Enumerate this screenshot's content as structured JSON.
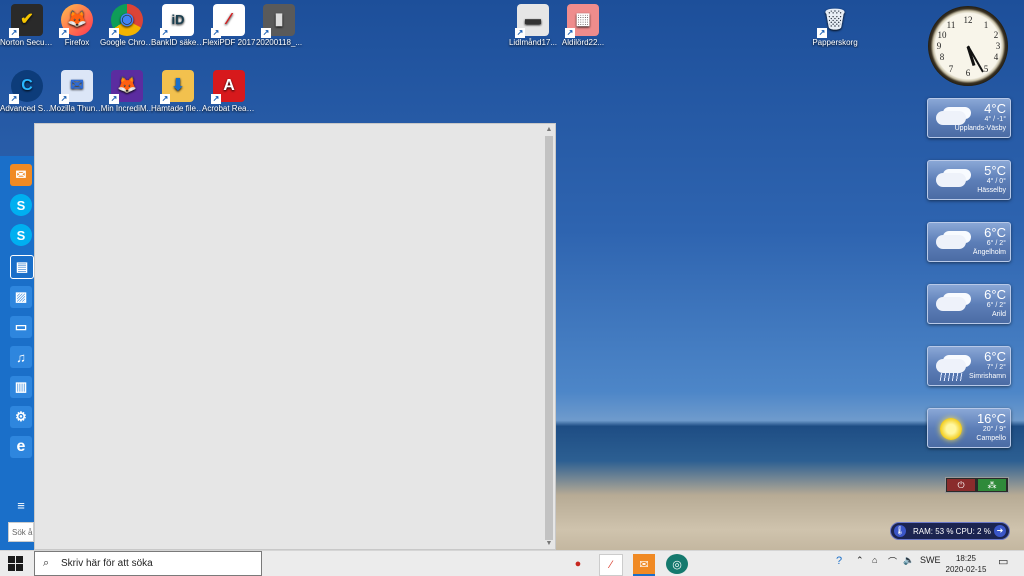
{
  "desktop_icons": [
    {
      "label": "Norton Security",
      "color": "#f5c400",
      "glyph": "✔"
    },
    {
      "label": "Firefox",
      "color": "#ff7139",
      "glyph": "🦊"
    },
    {
      "label": "Google Chrome",
      "color": "#ffffff",
      "glyph": "◉"
    },
    {
      "label": "BankID säkerhetspr...",
      "color": "#ffffff",
      "glyph": "iD"
    },
    {
      "label": "FlexiPDF 2017",
      "color": "#ffffff",
      "glyph": "⁄"
    },
    {
      "label": "20200118_...",
      "color": "#6a6a6a",
      "glyph": "▮"
    },
    {
      "label": "Advanced SystemCare",
      "color": "#0d3c7a",
      "glyph": "C"
    },
    {
      "label": "Mozilla Thunderbird",
      "color": "#2d6bd6",
      "glyph": "✉"
    },
    {
      "label": "Min IncrediM...",
      "color": "#5b2ca0",
      "glyph": "🦊"
    },
    {
      "label": "Hämtade filer - genväg",
      "color": "#f2c14e",
      "glyph": "⬇"
    },
    {
      "label": "Acrobat Reader DC",
      "color": "#d7191c",
      "glyph": "A"
    },
    {
      "label": "Lidlmånd17...",
      "color": "#dcdcdc",
      "glyph": "▬"
    },
    {
      "label": "Aldilörd22...",
      "color": "#ef8c8c",
      "glyph": "▦"
    },
    {
      "label": "Papperskorg",
      "color": "#cfd8e6",
      "glyph": "🗑"
    }
  ],
  "start_rail": {
    "items": [
      {
        "name": "mail-icon",
        "glyph": "✉",
        "color": "#f08a24"
      },
      {
        "name": "skype-icon",
        "glyph": "S",
        "color": "#00aff0"
      },
      {
        "name": "skype-icon",
        "glyph": "S",
        "color": "#00aff0"
      },
      {
        "name": "store-icon",
        "glyph": "▤",
        "color": "#1a6fc9"
      },
      {
        "name": "photos-icon",
        "glyph": "▨",
        "color": "#1a6fc9"
      },
      {
        "name": "video-icon",
        "glyph": "▭",
        "color": "#1a6fc9"
      },
      {
        "name": "music-icon",
        "glyph": "♫",
        "color": "#1a6fc9"
      },
      {
        "name": "files-icon",
        "glyph": "▥",
        "color": "#1a6fc9"
      },
      {
        "name": "settings-icon",
        "glyph": "⚙",
        "color": "#1a6fc9"
      },
      {
        "name": "edge-icon",
        "glyph": "e",
        "color": "#1a6fc9"
      },
      {
        "name": "menu-icon",
        "glyph": "≡",
        "color": "#1a6fc9"
      }
    ],
    "search_text": "Sök å"
  },
  "clock": {
    "hour": 5,
    "minute": 25
  },
  "weather": [
    {
      "temp": "4°C",
      "range": "4° / -1°",
      "city": "Upplands-Väsby",
      "icon": "cloud"
    },
    {
      "temp": "5°C",
      "range": "4° / 0°",
      "city": "Hässelby",
      "icon": "cloud"
    },
    {
      "temp": "6°C",
      "range": "6° / 2°",
      "city": "Ängelholm",
      "icon": "cloud"
    },
    {
      "temp": "6°C",
      "range": "6° / 2°",
      "city": "Arild",
      "icon": "cloud"
    },
    {
      "temp": "6°C",
      "range": "7° / 2°",
      "city": "Simrishamn",
      "icon": "rain"
    },
    {
      "temp": "16°C",
      "range": "20° / 9°",
      "city": "Campello",
      "icon": "sun"
    }
  ],
  "sysmon": {
    "text": "RAM: 53 %  CPU: 2 %"
  },
  "taskbar": {
    "search_placeholder": "Skriv här för att söka",
    "apps": [
      {
        "name": "app-red-icon",
        "glyph": "●",
        "color": "#c7271f"
      },
      {
        "name": "flexipdf-icon",
        "glyph": "⁄",
        "color": "#d93b2b"
      },
      {
        "name": "mail-icon",
        "glyph": "✉",
        "color": "#f08a24"
      },
      {
        "name": "app-green-icon",
        "glyph": "◎",
        "color": "#157a6e"
      }
    ],
    "language": "SWE",
    "time": "18:25",
    "date": "2020-02-15"
  }
}
